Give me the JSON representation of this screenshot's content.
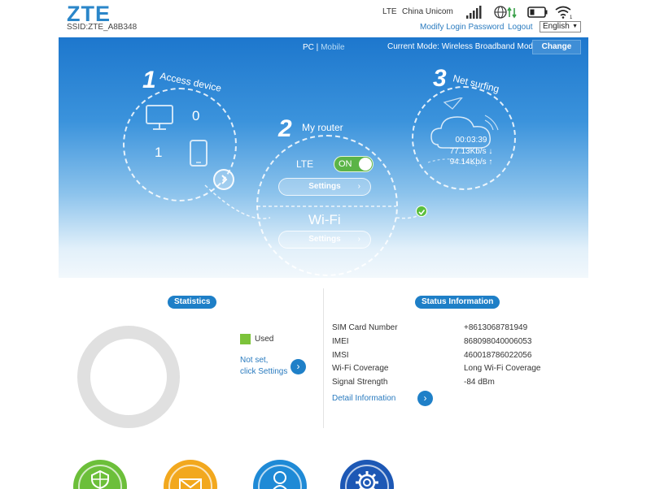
{
  "header": {
    "logo": "ZTE",
    "ssid": "SSID:ZTE_A8B348",
    "network_type": "LTE",
    "carrier": "China Unicom",
    "modify_password": "Modify Login Password",
    "logout": "Logout",
    "language": "English"
  },
  "banner": {
    "view_pc": "PC",
    "view_sep": " | ",
    "view_mobile": "Mobile",
    "mode": "Current Mode: Wireless Broadband Mode",
    "change_button": "Change",
    "step1": {
      "num": "1",
      "label": "Access device",
      "pc_count": "0",
      "mobile_count": "1"
    },
    "step2": {
      "num": "2",
      "label": "My router",
      "lte_label": "LTE",
      "toggle_label": "ON",
      "settings1": "Settings",
      "wifi_label": "Wi-Fi",
      "settings2": "Settings"
    },
    "step3": {
      "num": "3",
      "label": "Net surfing",
      "duration": "00:03:39",
      "download": "77.13Kb/s ↓",
      "upload": "94.14Kb/s ↑"
    }
  },
  "statistics": {
    "badge": "Statistics",
    "legend_used": "Used",
    "not_set_line1": "Not set,",
    "not_set_line2": "click Settings"
  },
  "status": {
    "badge": "Status Information",
    "rows": [
      {
        "label": "SIM Card Number",
        "value": "+8613068781949"
      },
      {
        "label": "IMEI",
        "value": "868098040006053"
      },
      {
        "label": "IMSI",
        "value": "460018786022056"
      },
      {
        "label": "Wi-Fi Coverage",
        "value": "Long Wi-Fi Coverage"
      },
      {
        "label": "Signal Strength",
        "value": "-84 dBm"
      }
    ],
    "detail_link": "Detail Information"
  },
  "colors": {
    "brand_blue": "#2a86c9",
    "accent_green": "#7cc33a",
    "badge_blue": "#1e7fc7"
  },
  "shortcut_icons": [
    "shield-icon",
    "mail-icon",
    "user-icon",
    "gear-icon"
  ]
}
